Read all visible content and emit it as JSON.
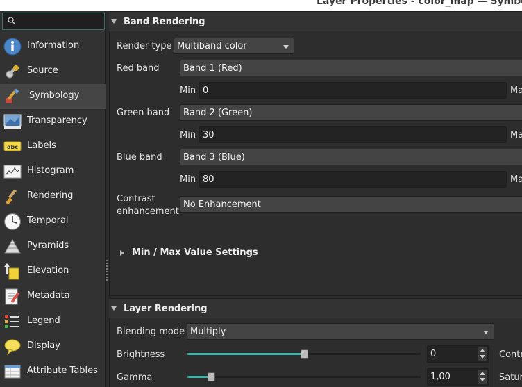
{
  "window": {
    "title": "Layer Properties - color_map — Symbology"
  },
  "search": {
    "placeholder": ""
  },
  "sidebar": {
    "items": [
      {
        "label": "Information",
        "icon": "information-icon"
      },
      {
        "label": "Source",
        "icon": "source-wrench-icon"
      },
      {
        "label": "Symbology",
        "icon": "symbology-brush-icon",
        "active": true
      },
      {
        "label": "Transparency",
        "icon": "transparency-icon"
      },
      {
        "label": "Labels",
        "icon": "labels-abc-icon"
      },
      {
        "label": "Histogram",
        "icon": "histogram-icon"
      },
      {
        "label": "Rendering",
        "icon": "rendering-brush-icon"
      },
      {
        "label": "Temporal",
        "icon": "clock-icon"
      },
      {
        "label": "Pyramids",
        "icon": "pyramids-icon"
      },
      {
        "label": "Elevation",
        "icon": "elevation-icon"
      },
      {
        "label": "Metadata",
        "icon": "metadata-icon"
      },
      {
        "label": "Legend",
        "icon": "legend-icon"
      },
      {
        "label": "Display",
        "icon": "display-bubble-icon"
      },
      {
        "label": "Attribute Tables",
        "icon": "attribute-table-icon"
      }
    ]
  },
  "band_rendering": {
    "title": "Band Rendering",
    "render_type_label": "Render type",
    "render_type_value": "Multiband color",
    "red": {
      "label": "Red band",
      "value": "Band 1 (Red)",
      "min_label": "Min",
      "min_value": "0",
      "max_label": "Ma"
    },
    "green": {
      "label": "Green band",
      "value": "Band 2 (Green)",
      "min_label": "Min",
      "min_value": "30",
      "max_label": "Ma"
    },
    "blue": {
      "label": "Blue band",
      "value": "Band 3 (Blue)",
      "min_label": "Min",
      "min_value": "80",
      "max_label": "Ma"
    },
    "contrast_label_1": "Contrast",
    "contrast_label_2": "enhancement",
    "contrast_value": "No Enhancement",
    "minmax_title": "Min / Max Value Settings"
  },
  "layer_rendering": {
    "title": "Layer Rendering",
    "blending_label": "Blending mode",
    "blending_value": "Multiply",
    "brightness_label": "Brightness",
    "brightness_value": "0",
    "brightness_level": 0.5,
    "contrast_right_label": "Contr",
    "gamma_label": "Gamma",
    "gamma_value": "1,00",
    "gamma_level": 0.1,
    "saturation_right_label": "Satur"
  },
  "colors": {
    "accent": "#3ab7a8",
    "background": "#2b2b2b"
  }
}
